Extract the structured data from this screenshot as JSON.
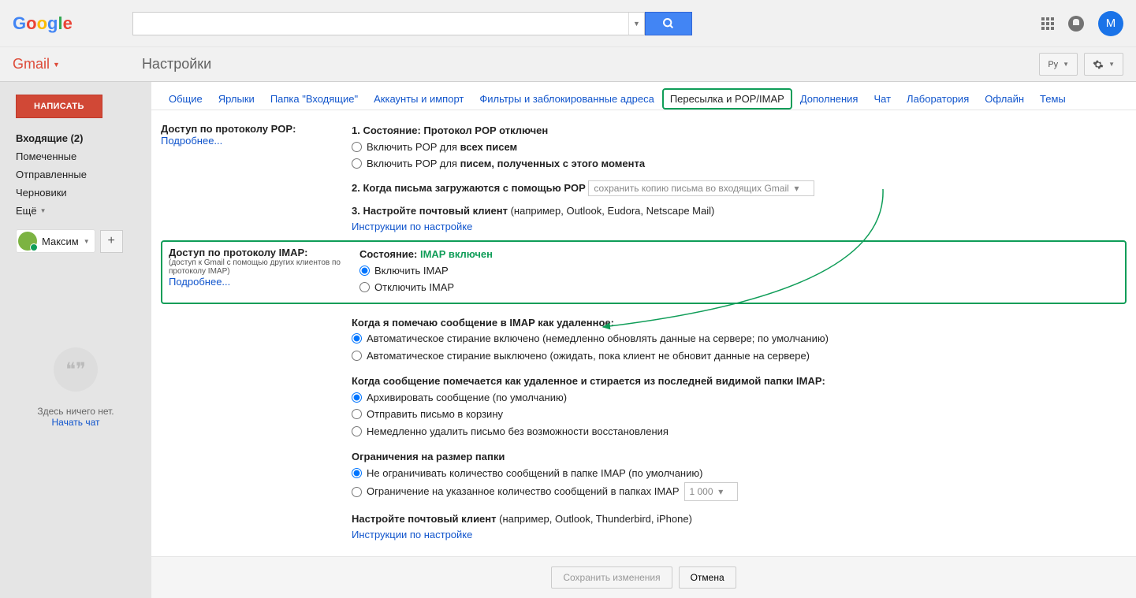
{
  "header": {
    "logo_letters": [
      "G",
      "o",
      "o",
      "g",
      "l",
      "e"
    ],
    "avatar_letter": "М"
  },
  "subbar": {
    "gmail_label": "Gmail",
    "page_title": "Настройки",
    "lang_code": "Ру"
  },
  "sidebar": {
    "compose": "НАПИСАТЬ",
    "items": [
      {
        "label": "Входящие (2)",
        "bold": true
      },
      {
        "label": "Помеченные"
      },
      {
        "label": "Отправленные"
      },
      {
        "label": "Черновики"
      }
    ],
    "more": "Ещё",
    "user_name": "Максим",
    "hangouts_empty": "Здесь ничего нет.",
    "hangouts_start": "Начать чат"
  },
  "tabs": [
    "Общие",
    "Ярлыки",
    "Папка \"Входящие\"",
    "Аккаунты и импорт",
    "Фильтры и заблокированные адреса",
    "Пересылка и POP/IMAP",
    "Дополнения",
    "Чат",
    "Лаборатория",
    "Офлайн",
    "Темы"
  ],
  "active_tab_index": 5,
  "pop": {
    "heading": "Доступ по протоколу POP:",
    "more": "Подробнее...",
    "s1_label": "1. Состояние: Протокол POP отключен",
    "r1_prefix": "Включить POP для ",
    "r1_bold": "всех писем",
    "r2_prefix": "Включить POP для ",
    "r2_bold": "писем, полученных с этого момента",
    "s2_label": "2. Когда письма загружаются с помощью POP",
    "s2_select": "сохранить копию письма во входящих Gmail",
    "s3_label": "3. Настройте почтовый клиент ",
    "s3_example": "(например, Outlook, Eudora, Netscape Mail)",
    "s3_link": "Инструкции по настройке"
  },
  "imap": {
    "heading": "Доступ по протоколу IMAP:",
    "subtext": "(доступ к Gmail с помощью других клиентов по протоколу IMAP)",
    "more": "Подробнее...",
    "status_label": "Состояние: ",
    "status_value": "IMAP включен",
    "enable": "Включить IMAP",
    "disable": "Отключить IMAP",
    "del_heading": "Когда я помечаю сообщение в IMAP как удаленное:",
    "del_r1": "Автоматическое стирание включено (немедленно обновлять данные на сервере; по умолчанию)",
    "del_r2": "Автоматическое стирание выключено (ожидать, пока клиент не обновит данные на сервере)",
    "expunge_heading": "Когда сообщение помечается как удаленное и стирается из последней видимой папки IMAP:",
    "exp_r1": "Архивировать сообщение (по умолчанию)",
    "exp_r2": "Отправить письмо в корзину",
    "exp_r3": "Немедленно удалить письмо без возможности восстановления",
    "limit_heading": "Ограничения на размер папки",
    "lim_r1": "Не ограничивать количество сообщений в папке IMAP (по умолчанию)",
    "lim_r2": "Ограничение на указанное количество сообщений в папках IMAP",
    "lim_select": "1 000",
    "client_label": "Настройте почтовый клиент ",
    "client_example": "(например, Outlook, Thunderbird, iPhone)",
    "client_link": "Инструкции по настройке"
  },
  "footer": {
    "save": "Сохранить изменения",
    "cancel": "Отмена"
  }
}
